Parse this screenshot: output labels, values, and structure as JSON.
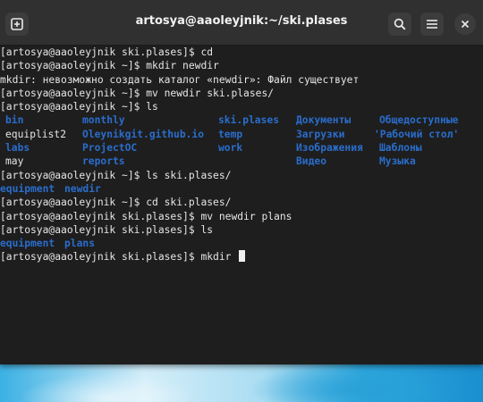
{
  "window": {
    "title": "artosya@aaoleyjnik:~/ski.plases"
  },
  "colors": {
    "titlebar": "#303030",
    "terminal_bg": "#1e1e1e",
    "text": "#e6e6e6",
    "directory": "#2a6dcc"
  },
  "icons": {
    "new_tab": "new-tab-icon",
    "search": "search-icon",
    "menu": "hamburger-menu-icon",
    "close": "close-icon"
  },
  "terminal": {
    "line1": "[artosya@aaoleyjnik ski.plases]$ cd",
    "line2": "[artosya@aaoleyjnik ~]$ mkdir newdir",
    "line3": "mkdir: невозможно создать каталог «newdir»: Файл существует",
    "line4": "[artosya@aaoleyjnik ~]$ mv newdir ski.plases/",
    "line5": "[artosya@aaoleyjnik ~]$ ls",
    "ls_home": [
      [
        "bin",
        "monthly",
        "ski.plases",
        "Документы",
        "Общедоступные"
      ],
      [
        "equiplist2",
        "Oleynikgit.github.io",
        "temp",
        "Загрузки",
        "'Рабочий стол'"
      ],
      [
        "labs",
        "ProjectOC",
        "work",
        "Изображения",
        "Шаблоны"
      ],
      [
        "may",
        "reports",
        "",
        "Видео",
        "Музыка"
      ]
    ],
    "line6": "[artosya@aaoleyjnik ~]$ ls ski.plases/",
    "ls_ski1": [
      "equipment",
      "newdir"
    ],
    "line7": "[artosya@aaoleyjnik ~]$ cd ski.plases/",
    "line8": "[artosya@aaoleyjnik ski.plases]$ mv newdir plans",
    "line9": "[artosya@aaoleyjnik ski.plases]$ ls",
    "ls_ski2": [
      "equipment",
      "plans"
    ],
    "line10": "[artosya@aaoleyjnik ski.plases]$ mkdir "
  }
}
